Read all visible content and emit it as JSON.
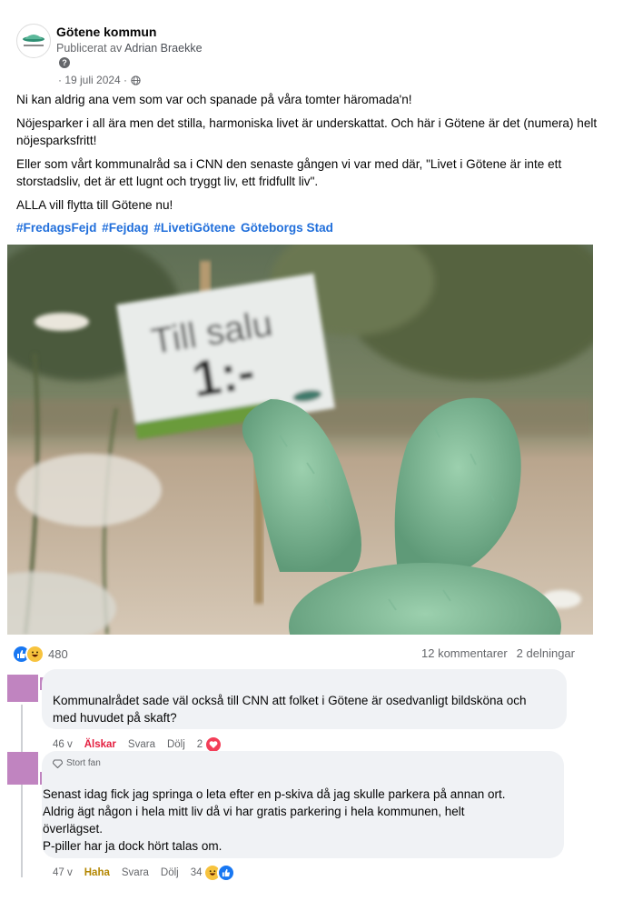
{
  "post": {
    "page_name": "Götene kommun",
    "publisher_prefix": "Publicerat av",
    "publisher_name": "Adrian Braekke",
    "date": "· 19 juli 2024 ·",
    "paragraphs": [
      "Ni kan aldrig ana vem som var och spanade på våra tomter häromada'n!",
      "Nöjesparker i all ära men det stilla, harmoniska livet är underskattat. Och här i Götene är det (numera) helt nöjesparksfritt!",
      "Eller som vårt kommunalråd sa i CNN den senaste gången vi var med där, \"Livet i Götene är inte ett storstadsliv, det är ett lugnt och tryggt liv, ett fridfullt liv\".",
      "ALLA vill flytta till Götene nu!"
    ],
    "hashtags": [
      "#FredagsFejd",
      "#Fejdag",
      "#LivetiGötene",
      "Göteborgs Stad"
    ],
    "photo": {
      "sign_line1": "Till salu",
      "sign_line2": "1:-"
    },
    "reactions_count": "480",
    "comments_count": "12 kommentarer",
    "shares_count": "2 delningar"
  },
  "comments": [
    {
      "text_lines": [
        "Kommunalrådet sade väl också till CNN att folket i Götene är osedvanligt bildsköna och",
        "med huvudet på skaft?"
      ],
      "time": "46 v",
      "reaction_label": "Älskar",
      "reply": "Svara",
      "hide": "Dölj",
      "reaction_count": "2"
    },
    {
      "badge": "Stort fan",
      "text_lines": [
        "Senast idag fick jag springa o leta efter en p-skiva då jag skulle parkera på annan ort.",
        "Aldrig ägt någon i hela mitt liv då vi har gratis parkering i hela kommunen, helt",
        "överlägset.",
        "P-piller har ja dock hört talas om."
      ],
      "time": "47 v",
      "reaction_label": "Haha",
      "reply": "Svara",
      "hide": "Dölj",
      "reaction_count": "34"
    }
  ],
  "colors": {
    "link": "#216fdb",
    "love": "#e41e3f",
    "haha": "#b38600",
    "redaction": "#c084c0"
  }
}
